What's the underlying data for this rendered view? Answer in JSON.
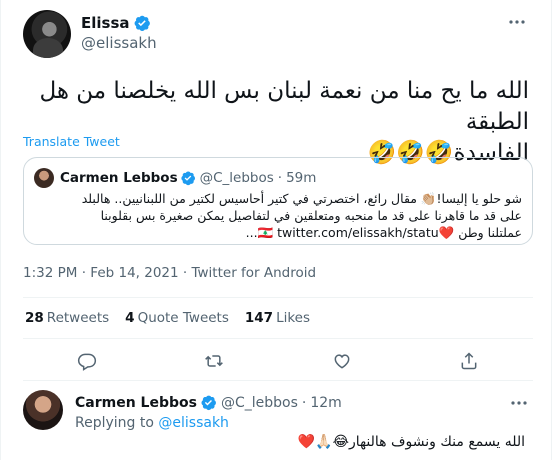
{
  "tweet": {
    "author": {
      "name": "Elissa",
      "handle": "@elissakh"
    },
    "text_line1": "الله ما يح منا من نعمة لبنان بس الله يخلصنا من هل الطبقة",
    "text_line2": "الفاسدة🤣🤣🤣",
    "translate": "Translate Tweet",
    "quoted": {
      "name": "Carmen Lebbos",
      "handle": "@C_lebbos",
      "time": "59m",
      "line1": "شو حلو يا إليسا!👏🏼 مقال رائع، اختصرتي في كتير أحاسيس لكتير من اللبنانيين.. هالبلد",
      "line2": "على قد ما قاهرنا على قد ما منحبه ومتعلقين في لتفاصيل يمكن صغيرة بس بقلوبنا",
      "line3": "عملتلنا وطن ❤️🇱🇧 twitter.com/elissakh/statu..."
    },
    "time": "1:32 PM",
    "date": "Feb 14, 2021",
    "source": "Twitter for Android",
    "separator": "·",
    "stats": [
      {
        "count": "28",
        "label": "Retweets"
      },
      {
        "count": "4",
        "label": "Quote Tweets"
      },
      {
        "count": "147",
        "label": "Likes"
      }
    ]
  },
  "actions": [
    "reply-icon",
    "retweet-icon",
    "like-icon",
    "share-icon"
  ],
  "reply": {
    "name": "Carmen Lebbos",
    "handle": "@C_lebbos",
    "time": "12m",
    "replying_prefix": "Replying to",
    "replying_to": "@elissakh",
    "text": "الله يسمع منك ونشوف هالنهار😂🙏🏻❤️"
  },
  "colors": {
    "accent": "#1d9bf0",
    "secondary_text": "#536471",
    "border": "#cfd9de"
  }
}
